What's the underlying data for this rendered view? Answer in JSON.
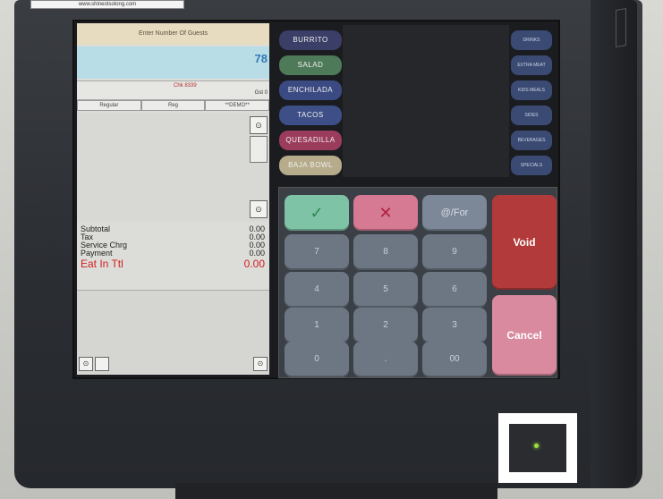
{
  "order_panel": {
    "guest_prompt": "Enter Number Of Guests",
    "guest_value": "78",
    "check_label": "Chk 8339",
    "guest_count_label": "Gst 0",
    "tabs": [
      "Regular",
      "Reg",
      "**DEMO**"
    ],
    "totals": [
      {
        "label": "Subtotal",
        "value": "0.00"
      },
      {
        "label": "Tax",
        "value": "0.00"
      },
      {
        "label": "Service Chrg",
        "value": "0.00"
      },
      {
        "label": "Payment",
        "value": "0.00"
      }
    ],
    "eat_in_total": {
      "label": "Eat In Ttl",
      "value": "0.00"
    }
  },
  "menu_items": [
    {
      "label": "BURRITO",
      "color": "#3b3e66"
    },
    {
      "label": "SALAD",
      "color": "#4f7a5a"
    },
    {
      "label": "ENCHILADA",
      "color": "#3b4a82"
    },
    {
      "label": "TACOS",
      "color": "#3d4f86"
    },
    {
      "label": "QUESADILLA",
      "color": "#9c3c5c"
    },
    {
      "label": "BAJA BOWL",
      "color": "#b6ab8a"
    }
  ],
  "right_menu": [
    "DRINKS",
    "EXTRA MEAT",
    "KIDS MEALS",
    "SIDES",
    "BEVERAGES",
    "SPECIALS"
  ],
  "keypad": {
    "for_label": "@/For",
    "void_label": "Void",
    "cancel_label": "Cancel",
    "keys": [
      "7",
      "8",
      "9",
      "4",
      "5",
      "6",
      "1",
      "2",
      "3",
      "0",
      ".",
      "00"
    ],
    "check_icon": "✓",
    "x_icon": "✕"
  },
  "sticker_text": "www.shineotsolong.com"
}
